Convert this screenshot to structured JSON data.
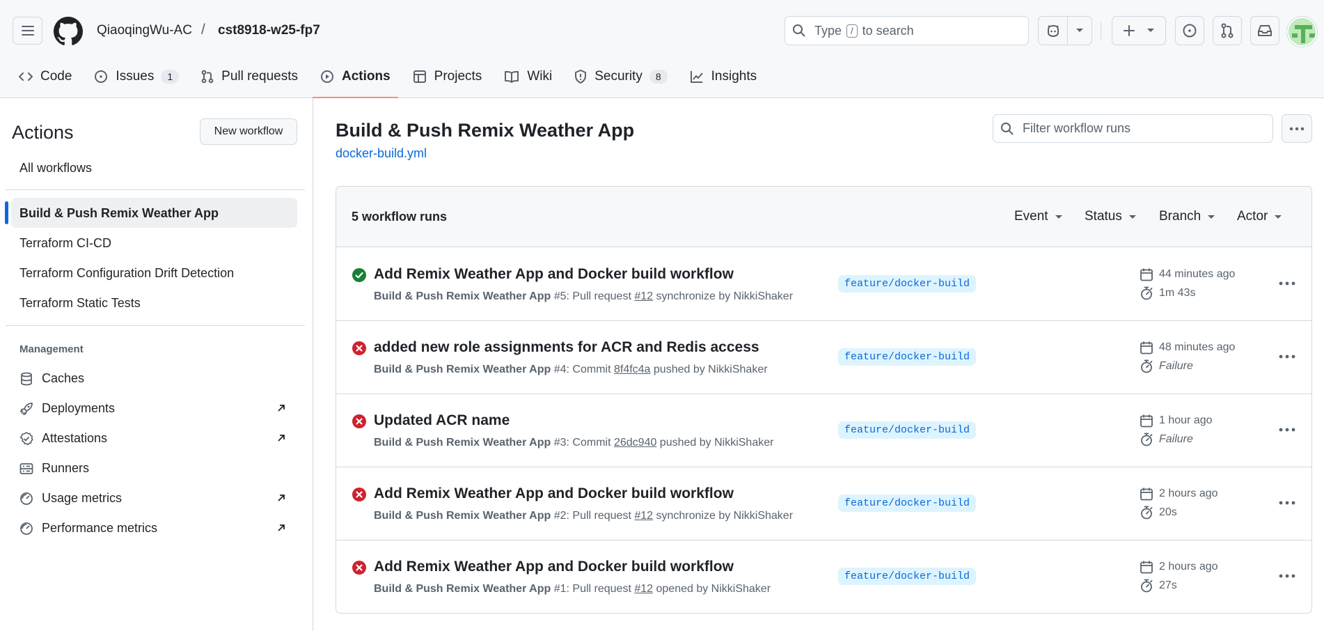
{
  "header": {
    "owner": "QiaoqingWu-AC",
    "separator": "/",
    "repo": "cst8918-w25-fp7",
    "search_type": "Type",
    "search_key": "/",
    "search_rest": "to search"
  },
  "tabs": [
    {
      "label": "Code",
      "icon": "code-icon"
    },
    {
      "label": "Issues",
      "icon": "issue-icon",
      "count": "1"
    },
    {
      "label": "Pull requests",
      "icon": "pull-request-icon"
    },
    {
      "label": "Actions",
      "icon": "play-icon",
      "active": true
    },
    {
      "label": "Projects",
      "icon": "table-icon"
    },
    {
      "label": "Wiki",
      "icon": "book-icon"
    },
    {
      "label": "Security",
      "icon": "shield-icon",
      "count": "8"
    },
    {
      "label": "Insights",
      "icon": "graph-icon"
    }
  ],
  "sidebar": {
    "title": "Actions",
    "new_workflow": "New workflow",
    "all_workflows": "All workflows",
    "workflows": [
      "Build & Push Remix Weather App",
      "Terraform CI-CD",
      "Terraform Configuration Drift Detection",
      "Terraform Static Tests"
    ],
    "management_heading": "Management",
    "management": [
      {
        "label": "Caches",
        "icon": "database-icon"
      },
      {
        "label": "Deployments",
        "icon": "rocket-icon",
        "external": true
      },
      {
        "label": "Attestations",
        "icon": "verified-icon",
        "external": true
      },
      {
        "label": "Runners",
        "icon": "server-icon"
      },
      {
        "label": "Usage metrics",
        "icon": "meter-icon",
        "external": true
      },
      {
        "label": "Performance metrics",
        "icon": "meter-icon",
        "external": true
      }
    ]
  },
  "main": {
    "title": "Build & Push Remix Weather App",
    "file_link": "docker-build.yml",
    "filter_placeholder": "Filter workflow runs",
    "runs_count": "5 workflow runs",
    "filters": [
      "Event",
      "Status",
      "Branch",
      "Actor"
    ]
  },
  "runs": [
    {
      "status": "success",
      "title": "Add Remix Weather App and Docker build workflow",
      "workflow": "Build & Push Remix Weather App",
      "number": "#5",
      "prefix": ": Pull request ",
      "ref": "#12",
      "suffix": " synchronize by NikkiShaker",
      "branch": "feature/docker-build",
      "time": "44 minutes ago",
      "duration": "1m 43s"
    },
    {
      "status": "failure",
      "title": "added new role assignments for ACR and Redis access",
      "workflow": "Build & Push Remix Weather App",
      "number": "#4",
      "prefix": ": Commit ",
      "ref": "8f4fc4a",
      "suffix": " pushed by NikkiShaker",
      "branch": "feature/docker-build",
      "time": "48 minutes ago",
      "duration": "Failure"
    },
    {
      "status": "failure",
      "title": "Updated ACR name",
      "workflow": "Build & Push Remix Weather App",
      "number": "#3",
      "prefix": ": Commit ",
      "ref": "26dc940",
      "suffix": " pushed by NikkiShaker",
      "branch": "feature/docker-build",
      "time": "1 hour ago",
      "duration": "Failure"
    },
    {
      "status": "failure",
      "title": "Add Remix Weather App and Docker build workflow",
      "workflow": "Build & Push Remix Weather App",
      "number": "#2",
      "prefix": ": Pull request ",
      "ref": "#12",
      "suffix": " synchronize by NikkiShaker",
      "branch": "feature/docker-build",
      "time": "2 hours ago",
      "duration": "20s"
    },
    {
      "status": "failure",
      "title": "Add Remix Weather App and Docker build workflow",
      "workflow": "Build & Push Remix Weather App",
      "number": "#1",
      "prefix": ": Pull request ",
      "ref": "#12",
      "suffix": " opened by NikkiShaker",
      "branch": "feature/docker-build",
      "time": "2 hours ago",
      "duration": "27s"
    }
  ],
  "colors": {
    "accent": "#0969da",
    "success": "#1a7f37",
    "failure": "#cf222e",
    "tab_underline": "#fd8c73"
  }
}
